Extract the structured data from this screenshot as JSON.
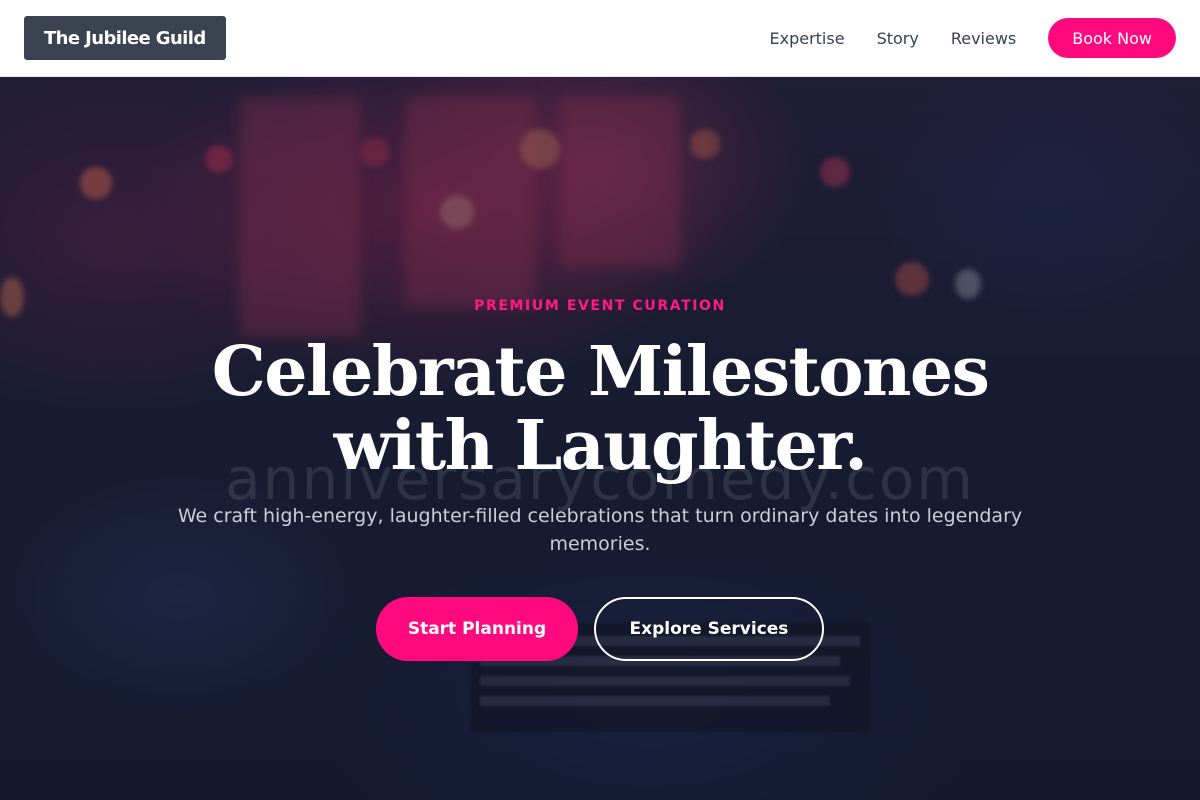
{
  "header": {
    "logo_text": "The Jubilee Guild",
    "nav": [
      {
        "label": "Expertise"
      },
      {
        "label": "Story"
      },
      {
        "label": "Reviews"
      }
    ],
    "cta_label": "Book Now"
  },
  "hero": {
    "eyebrow": "PREMIUM EVENT CURATION",
    "headline_line1": "Celebrate Milestones",
    "headline_line2": "with Laughter.",
    "watermark": "anniversarycomedy.com",
    "subtext": "We craft high-energy, laughter-filled celebrations that turn ordinary dates into legendary memories.",
    "primary_button": "Start Planning",
    "secondary_button": "Explore Services"
  },
  "colors": {
    "accent": "#ff0a7e",
    "logo_bg": "#3b4351",
    "hero_bg": "#161b30"
  }
}
